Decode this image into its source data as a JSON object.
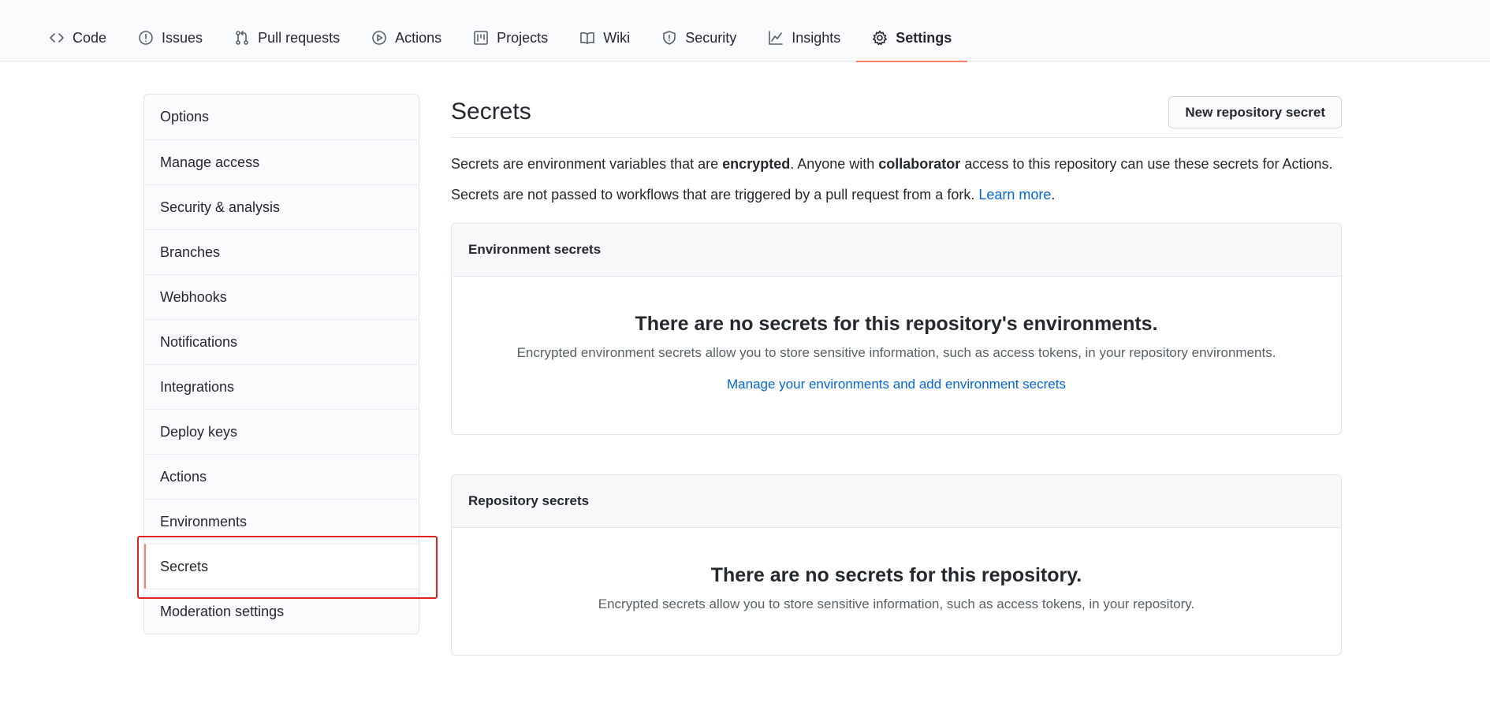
{
  "nav": {
    "tabs": [
      {
        "label": "Code",
        "icon": "code-icon"
      },
      {
        "label": "Issues",
        "icon": "issue-icon"
      },
      {
        "label": "Pull requests",
        "icon": "pull-request-icon"
      },
      {
        "label": "Actions",
        "icon": "play-icon"
      },
      {
        "label": "Projects",
        "icon": "project-icon"
      },
      {
        "label": "Wiki",
        "icon": "book-icon"
      },
      {
        "label": "Security",
        "icon": "shield-icon"
      },
      {
        "label": "Insights",
        "icon": "graph-icon"
      },
      {
        "label": "Settings",
        "icon": "gear-icon",
        "selected": true
      }
    ]
  },
  "sidebar": {
    "items": [
      {
        "label": "Options"
      },
      {
        "label": "Manage access"
      },
      {
        "label": "Security & analysis"
      },
      {
        "label": "Branches"
      },
      {
        "label": "Webhooks"
      },
      {
        "label": "Notifications"
      },
      {
        "label": "Integrations"
      },
      {
        "label": "Deploy keys"
      },
      {
        "label": "Actions"
      },
      {
        "label": "Environments"
      },
      {
        "label": "Secrets",
        "selected": true
      },
      {
        "label": "Moderation settings"
      }
    ]
  },
  "main": {
    "title": "Secrets",
    "new_button": "New repository secret",
    "desc1": {
      "part1": "Secrets are environment variables that are ",
      "bold1": "encrypted",
      "part2": ". Anyone with ",
      "bold2": "collaborator",
      "part3": " access to this repository can use these secrets for Actions."
    },
    "desc2": {
      "text": "Secrets are not passed to workflows that are triggered by a pull request from a fork. ",
      "link": "Learn more",
      "end": "."
    },
    "env_box": {
      "header": "Environment secrets",
      "title": "There are no secrets for this repository's environments.",
      "description": "Encrypted environment secrets allow you to store sensitive information, such as access tokens, in your repository environments.",
      "link": "Manage your environments and add environment secrets"
    },
    "repo_box": {
      "header": "Repository secrets",
      "title": "There are no secrets for this repository.",
      "description": "Encrypted secrets allow you to store sensitive information, such as access tokens, in your repository."
    }
  },
  "colors": {
    "accent_underline": "#f9826c",
    "link": "#0366d6",
    "highlight_box": "#e02424"
  }
}
